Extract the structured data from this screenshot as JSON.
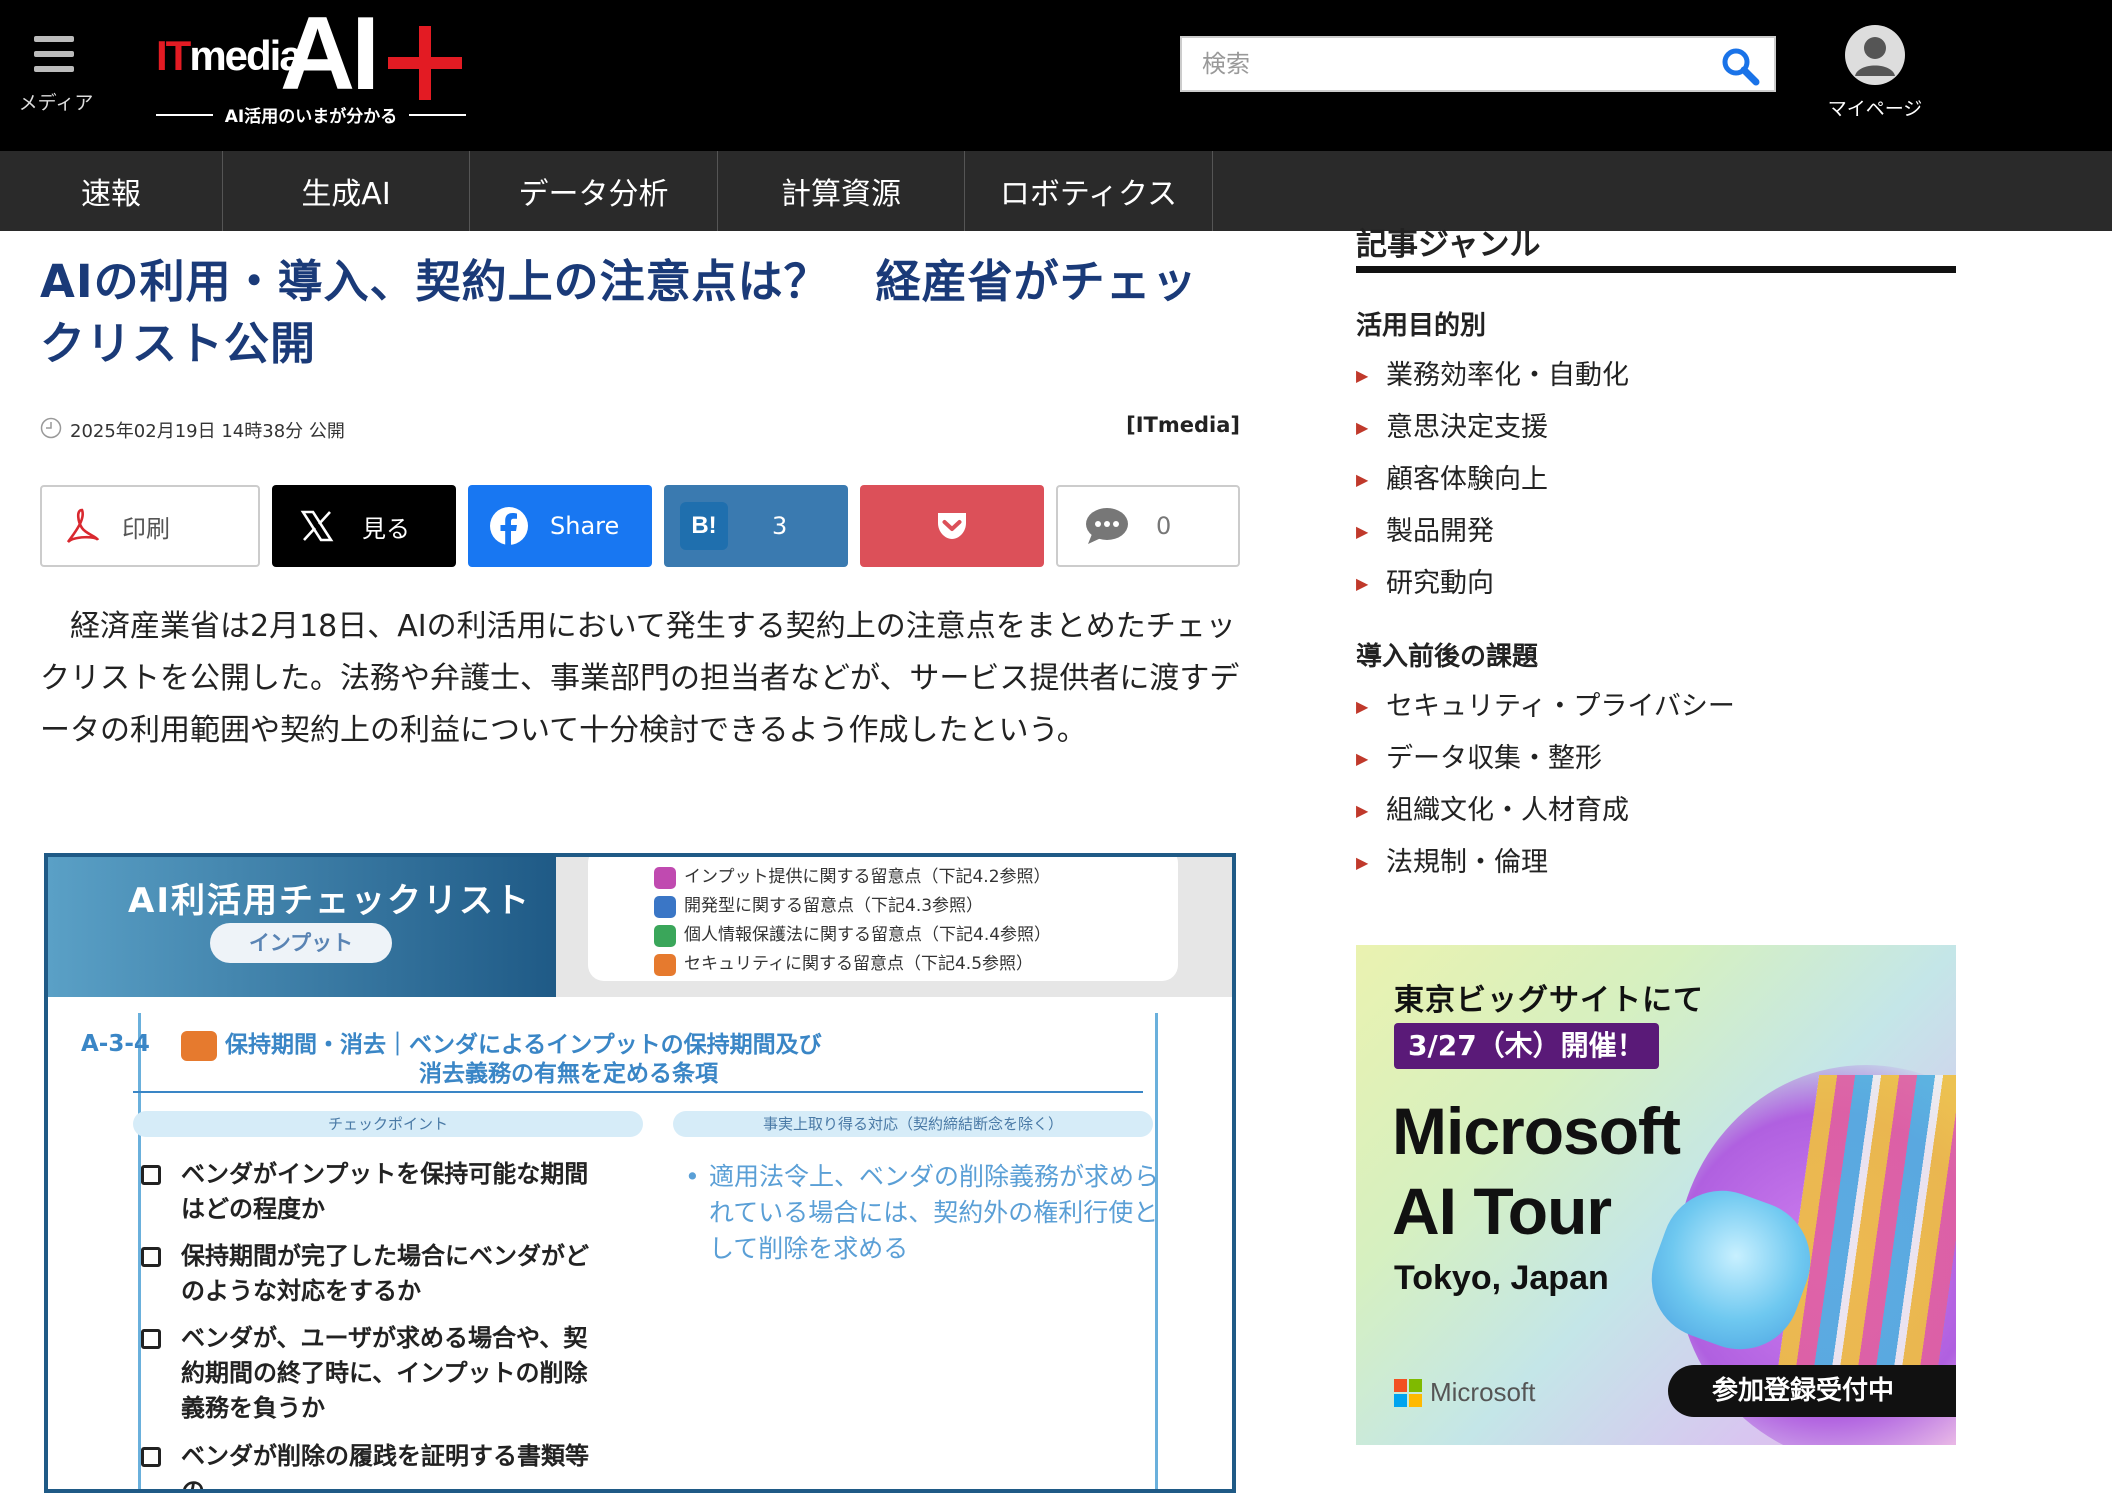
{
  "header": {
    "menu_label": "メディア",
    "logo_it": "IT",
    "logo_media": "media",
    "logo_ai": "AI",
    "tagline": "AI活用のいまが分かる",
    "search_placeholder": "検索",
    "mypage_label": "マイページ",
    "colors": {
      "background": "#000000",
      "brand_red": "#e31b23"
    }
  },
  "nav": {
    "items": [
      {
        "label": "速報"
      },
      {
        "label": "生成AI"
      },
      {
        "label": "データ分析"
      },
      {
        "label": "計算資源"
      },
      {
        "label": "ロボティクス"
      }
    ]
  },
  "article": {
    "title_line1": "AIの利用・導入、契約上の注意点は？　経産省がチェッ",
    "title_line2": "クリスト公開",
    "date": "2025年02月19日 14時38分 公開",
    "source": "[ITmedia]",
    "share": {
      "print_label": "印刷",
      "x_label": "見る",
      "facebook_label": "Share",
      "hatena_icon_text": "B!",
      "hatena_count": "3",
      "comment_count": "0"
    },
    "lead": "　経済産業省は2月18日、AIの利活用において発生する契約上の注意点をまとめたチェックリストを公開した。法務や弁護士、事業部門の担当者などが、サービス提供者に渡すデータの利用範囲や契約上の利益について十分検討できるよう作成したという。",
    "figure": {
      "title": "AI利活用チェックリスト",
      "pill": "インプット",
      "legend": [
        {
          "text": "インプット提供に関する留意点（下記4.2参照）",
          "color": "#c04ab0"
        },
        {
          "text": "開発型に関する留意点（下記4.3参照）",
          "color": "#3a76c6"
        },
        {
          "text": "個人情報保護法に関する留意点（下記4.4参照）",
          "color": "#3aa65a"
        },
        {
          "text": "セキュリティに関する留意点（下記4.5参照）",
          "color": "#e67a2e"
        }
      ],
      "code": "A-3-4",
      "heading_line1": "保持期間・消去｜ベンダによるインプットの保持期間及び",
      "heading_line2": "消去義務の有無を定める条項",
      "left_column_label": "チェックポイント",
      "right_column_label": "事実上取り得る対応（契約締結断念を除く）",
      "checkpoints": [
        "ベンダがインプットを保持可能な期間はどの程度か",
        "保持期間が完了した場合にベンダがどのような対応をするか",
        "ベンダが、ユーザが求める場合や、契約期間の終了時に、インプットの削除義務を負うか",
        "ベンダが削除の履践を証明する書類等の"
      ],
      "response": "適用法令上、ベンダの削除義務が求められている場合には、契約外の権利行使として削除を求める"
    }
  },
  "sidebar": {
    "title": "記事ジャンル",
    "groups": [
      {
        "label": "活用目的別",
        "items": [
          "業務効率化・自動化",
          "意思決定支援",
          "顧客体験向上",
          "製品開発",
          "研究動向"
        ]
      },
      {
        "label": "導入前後の課題",
        "items": [
          "セキュリティ・プライバシー",
          "データ収集・整形",
          "組織文化・人材育成",
          "法規制・倫理"
        ]
      }
    ],
    "ad": {
      "line1": "東京ビッグサイトにて",
      "date": "3/27（木）開催！",
      "big1": "Microsoft",
      "big2": "AI Tour",
      "location": "Tokyo, Japan",
      "brand": "Microsoft",
      "cta": "参加登録受付中"
    }
  }
}
